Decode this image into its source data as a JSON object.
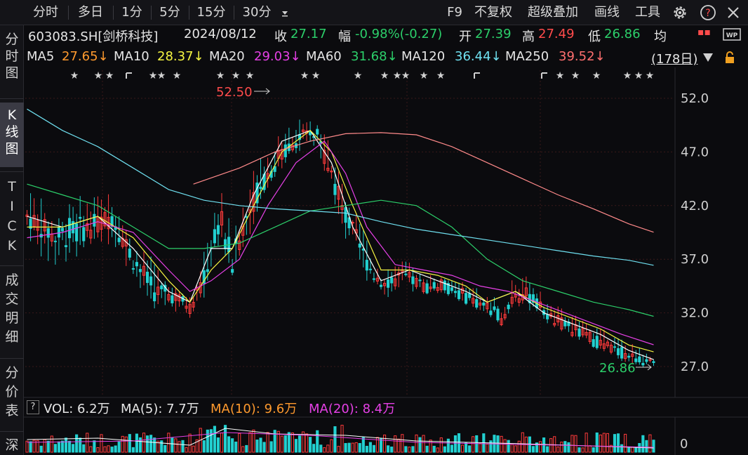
{
  "toolbar": {
    "tabs": [
      "分时",
      "多日",
      "1分",
      "5分",
      "15分",
      "30分"
    ],
    "dropdown_icon": "caret-down-icon",
    "right_items": [
      "F9",
      "不复权",
      "超级叠加",
      "画线",
      "工具"
    ],
    "icons": [
      "gear-icon",
      "help-icon",
      "collapse-icon"
    ]
  },
  "sidebar": {
    "tabs": [
      {
        "label": "分时图",
        "active": false
      },
      {
        "label": "K线图",
        "active": true
      },
      {
        "label": "TICK",
        "active": false
      },
      {
        "label": "成交明细",
        "active": false
      },
      {
        "label": "分价表",
        "active": false
      },
      {
        "label": "深",
        "active": false
      }
    ]
  },
  "quote": {
    "code_name": "603083.SH[剑桥科技]",
    "date": "2024/08/12",
    "close_label": "收",
    "close": "27.17",
    "change_label": "幅",
    "change": "-0.98%(-0.27)",
    "open_label": "开",
    "open": "27.39",
    "high_label": "高",
    "high": "27.49",
    "low_label": "低",
    "low": "26.86",
    "avg_label": "均",
    "wp_icon": "wp-icon"
  },
  "ma_line": [
    {
      "label": "MA5",
      "value": "27.65↓",
      "color": "#ff9a2e"
    },
    {
      "label": "MA10",
      "value": "28.37↓",
      "color": "#f5f542"
    },
    {
      "label": "MA20",
      "value": "29.03↓",
      "color": "#e640e6"
    },
    {
      "label": "MA60",
      "value": "31.68↓",
      "color": "#2ccf6a"
    },
    {
      "label": "MA120",
      "value": "36.44↓",
      "color": "#6fe0f0"
    },
    {
      "label": "MA250",
      "value": "39.52↓",
      "color": "#ff6f6f"
    }
  ],
  "period_selector": "(178日)",
  "lock_icon": "lock-icon",
  "annotations": {
    "high_mark": "52.50",
    "low_mark": "26.86"
  },
  "colors": {
    "up": "#ff3b3b",
    "down": "#22d0d0",
    "ma5": "#ffffff",
    "ma10": "#f5f542",
    "ma20": "#e640e6",
    "ma60": "#2ccf6a",
    "ma120": "#6fe0f0",
    "ma250": "#ff8a8a",
    "grid": "#3a1a1a"
  },
  "chart_data": {
    "type": "candlestick",
    "price_axis": {
      "ticks": [
        "52.0",
        "47.0",
        "42.0",
        "37.0",
        "32.0",
        "27.0"
      ],
      "range": [
        24.0,
        55.0
      ]
    },
    "bars": 178,
    "envelope": [
      [
        0,
        44,
        42,
        40,
        38
      ],
      [
        8,
        43,
        40,
        38,
        36
      ],
      [
        12,
        44,
        41,
        38,
        36
      ],
      [
        18,
        43,
        41,
        39,
        38
      ],
      [
        24,
        44,
        42,
        40,
        38
      ],
      [
        30,
        40,
        38,
        36,
        35
      ],
      [
        36,
        37,
        35,
        33,
        32
      ],
      [
        42,
        35,
        34,
        33,
        32
      ],
      [
        46,
        34,
        33,
        32,
        31.5
      ],
      [
        50,
        38,
        36,
        34,
        33
      ],
      [
        52,
        42,
        40,
        37,
        36
      ],
      [
        55,
        44,
        42,
        39,
        38
      ],
      [
        58,
        40,
        38,
        35,
        34
      ],
      [
        62,
        44,
        42,
        40,
        38
      ],
      [
        66,
        47,
        45,
        43,
        42
      ],
      [
        70,
        49,
        47,
        45,
        44
      ],
      [
        74,
        50,
        48,
        47,
        46
      ],
      [
        78,
        51,
        49,
        48,
        47
      ],
      [
        82,
        50,
        49,
        48,
        47
      ],
      [
        86,
        48,
        46,
        44,
        43
      ],
      [
        90,
        44,
        42,
        40,
        38
      ],
      [
        94,
        41,
        39,
        37,
        36
      ],
      [
        98,
        38,
        36,
        35,
        34
      ],
      [
        102,
        37,
        35,
        34,
        33
      ],
      [
        106,
        37,
        36,
        35,
        34
      ],
      [
        112,
        36,
        35,
        34,
        34
      ],
      [
        118,
        35,
        35,
        34,
        34
      ],
      [
        124,
        35,
        34,
        33,
        33
      ],
      [
        130,
        34,
        33,
        32,
        32
      ],
      [
        134,
        33,
        32,
        31,
        31
      ],
      [
        138,
        37,
        35,
        33,
        33
      ],
      [
        142,
        35,
        34,
        33,
        32
      ],
      [
        148,
        33,
        32,
        31,
        31
      ],
      [
        154,
        32,
        31,
        30,
        30
      ],
      [
        160,
        31,
        30,
        29,
        29
      ],
      [
        166,
        30,
        29,
        28,
        28
      ],
      [
        172,
        29,
        28,
        27.5,
        27
      ],
      [
        177,
        27.5,
        27.3,
        27.1,
        26.86
      ]
    ],
    "moving_averages": {
      "ma5": [
        [
          0,
          41
        ],
        [
          10,
          40
        ],
        [
          20,
          41
        ],
        [
          30,
          38
        ],
        [
          40,
          34
        ],
        [
          46,
          33
        ],
        [
          52,
          38
        ],
        [
          58,
          38
        ],
        [
          64,
          43
        ],
        [
          72,
          48
        ],
        [
          80,
          49
        ],
        [
          86,
          46
        ],
        [
          92,
          40
        ],
        [
          100,
          35
        ],
        [
          108,
          36
        ],
        [
          116,
          35
        ],
        [
          124,
          34
        ],
        [
          130,
          33
        ],
        [
          138,
          34
        ],
        [
          146,
          32
        ],
        [
          154,
          31
        ],
        [
          162,
          30
        ],
        [
          170,
          28.5
        ],
        [
          177,
          27.65
        ]
      ],
      "ma10": [
        [
          0,
          40
        ],
        [
          10,
          40
        ],
        [
          20,
          41
        ],
        [
          30,
          39
        ],
        [
          40,
          35
        ],
        [
          46,
          33
        ],
        [
          52,
          36
        ],
        [
          58,
          38
        ],
        [
          64,
          42
        ],
        [
          72,
          47
        ],
        [
          80,
          49
        ],
        [
          86,
          47
        ],
        [
          92,
          42
        ],
        [
          100,
          36
        ],
        [
          108,
          36
        ],
        [
          116,
          35.5
        ],
        [
          124,
          34.5
        ],
        [
          130,
          33
        ],
        [
          138,
          34
        ],
        [
          146,
          32.5
        ],
        [
          154,
          31.5
        ],
        [
          162,
          30.5
        ],
        [
          170,
          29
        ],
        [
          177,
          28.37
        ]
      ],
      "ma20": [
        [
          0,
          39
        ],
        [
          10,
          39.5
        ],
        [
          20,
          40.5
        ],
        [
          30,
          39.5
        ],
        [
          40,
          36
        ],
        [
          46,
          34
        ],
        [
          52,
          35
        ],
        [
          60,
          37
        ],
        [
          68,
          42
        ],
        [
          76,
          46
        ],
        [
          84,
          48
        ],
        [
          90,
          45
        ],
        [
          96,
          40
        ],
        [
          104,
          36.5
        ],
        [
          112,
          36
        ],
        [
          120,
          35.5
        ],
        [
          128,
          34.5
        ],
        [
          136,
          34
        ],
        [
          144,
          33
        ],
        [
          152,
          32
        ],
        [
          160,
          31
        ],
        [
          168,
          30
        ],
        [
          177,
          29.03
        ]
      ],
      "ma60": [
        [
          0,
          44
        ],
        [
          10,
          43
        ],
        [
          20,
          42
        ],
        [
          30,
          40
        ],
        [
          40,
          38
        ],
        [
          50,
          38
        ],
        [
          60,
          38.5
        ],
        [
          70,
          40
        ],
        [
          80,
          41.5
        ],
        [
          90,
          42
        ],
        [
          100,
          42.5
        ],
        [
          110,
          42
        ],
        [
          120,
          40
        ],
        [
          130,
          37
        ],
        [
          140,
          35
        ],
        [
          150,
          34
        ],
        [
          160,
          33
        ],
        [
          170,
          32.3
        ],
        [
          177,
          31.68
        ]
      ],
      "ma120": [
        [
          0,
          51
        ],
        [
          10,
          49
        ],
        [
          20,
          47.5
        ],
        [
          30,
          45.5
        ],
        [
          40,
          43.5
        ],
        [
          50,
          42.5
        ],
        [
          60,
          42
        ],
        [
          70,
          41.7
        ],
        [
          80,
          41.5
        ],
        [
          90,
          41.3
        ],
        [
          100,
          40.5
        ],
        [
          110,
          39.8
        ],
        [
          120,
          39.3
        ],
        [
          130,
          38.8
        ],
        [
          140,
          38.3
        ],
        [
          150,
          37.8
        ],
        [
          160,
          37.3
        ],
        [
          170,
          36.9
        ],
        [
          177,
          36.44
        ]
      ],
      "ma250": [
        [
          47,
          44
        ],
        [
          60,
          45.5
        ],
        [
          70,
          47
        ],
        [
          80,
          48
        ],
        [
          90,
          48.7
        ],
        [
          100,
          48.8
        ],
        [
          110,
          48.6
        ],
        [
          120,
          47.5
        ],
        [
          130,
          46
        ],
        [
          140,
          44.5
        ],
        [
          150,
          43
        ],
        [
          160,
          41.7
        ],
        [
          170,
          40.3
        ],
        [
          177,
          39.52
        ]
      ]
    }
  },
  "volume_panel": {
    "help_icon": "question-icon",
    "vol_label": "VOL: 6.2万",
    "ma5_label": "MA(5): 7.7万",
    "ma10_label": "MA(10): 9.6万",
    "ma20_label": "MA(20): 8.4万",
    "ma10_color": "#ff9a2e",
    "ma20_color": "#e640e6",
    "axis_zero": "0"
  }
}
